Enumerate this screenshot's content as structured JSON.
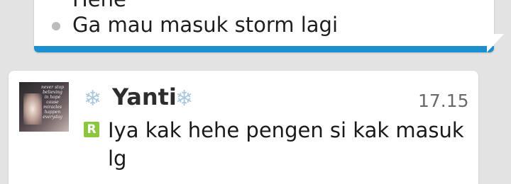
{
  "previous_message": {
    "lines": [
      "Hehe",
      "Ga mau masuk storm lagi"
    ]
  },
  "message": {
    "sender": "Yanti",
    "timestamp": "17.15",
    "status_badge": "R",
    "text": "Iya kak hehe pengen si kak masuk lg"
  },
  "colors": {
    "accent": "#1a8fd0",
    "read_badge": "#8cc641",
    "snowflake": "#a9c8dc"
  },
  "icons": {
    "decoration": "snowflake-icon",
    "read_status": "read-receipt-icon"
  }
}
